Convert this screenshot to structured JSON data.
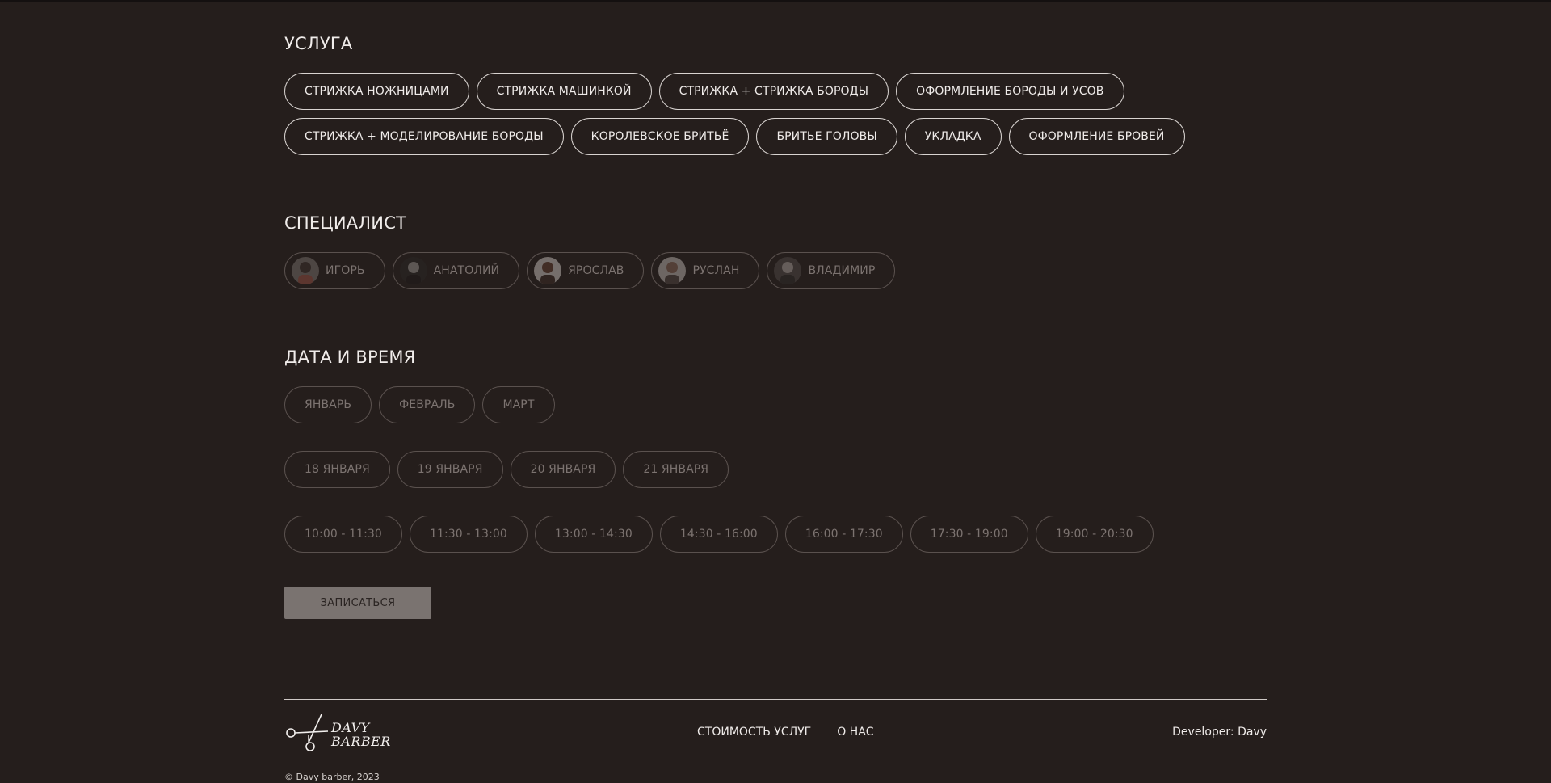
{
  "services": {
    "title": "УСЛУГА",
    "row1": [
      "СТРИЖКА НОЖНИЦАМИ",
      "СТРИЖКА МАШИНКОЙ",
      "СТРИЖКА + СТРИЖКА БОРОДЫ",
      "ОФОРМЛЕНИЕ БОРОДЫ И УСОВ"
    ],
    "row2": [
      "СТРИЖКА + МОДЕЛИРОВАНИЕ БОРОДЫ",
      "КОРОЛЕВСКОЕ БРИТЬЁ",
      "БРИТЬЕ ГОЛОВЫ",
      "УКЛАДКА",
      "ОФОРМЛЕНИЕ БРОВЕЙ"
    ]
  },
  "specialists": {
    "title": "СПЕЦИАЛИСТ",
    "items": [
      "ИГОРЬ",
      "АНАТОЛИЙ",
      "ЯРОСЛАВ",
      "РУСЛАН",
      "ВЛАДИМИР"
    ]
  },
  "datetime": {
    "title": "ДАТА И ВРЕМЯ",
    "months": [
      "ЯНВАРЬ",
      "ФЕВРАЛЬ",
      "МАРТ"
    ],
    "days": [
      "18 ЯНВАРЯ",
      "19 ЯНВАРЯ",
      "20 ЯНВАРЯ",
      "21 ЯНВАРЯ"
    ],
    "times": [
      "10:00 - 11:30",
      "11:30 - 13:00",
      "13:00 - 14:30",
      "14:30 - 16:00",
      "16:00 - 17:30",
      "17:30 - 19:00",
      "19:00 - 20:30"
    ]
  },
  "submit_label": "ЗАПИСАТЬСЯ",
  "footer": {
    "logo_line1": "DAVY",
    "logo_line2": "BARBER",
    "nav": [
      "СТОИМОСТЬ УСЛУГ",
      "О НАС"
    ],
    "developer": "Developer: Davy",
    "copyright": "© Davy barber, 2023"
  }
}
